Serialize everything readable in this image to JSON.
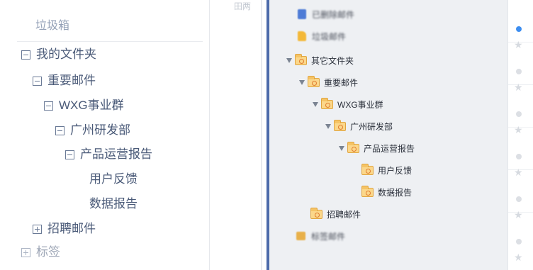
{
  "left_tree": {
    "trash_label": "垃圾箱",
    "items": [
      {
        "label": "我的文件夹",
        "expander": "minus"
      },
      {
        "label": "重要邮件",
        "expander": "minus"
      },
      {
        "label": "WXG事业群",
        "expander": "minus"
      },
      {
        "label": "广州研发部",
        "expander": "minus"
      },
      {
        "label": "产品运营报告",
        "expander": "minus"
      },
      {
        "label": "用户反馈",
        "expander": "none"
      },
      {
        "label": "数据报告",
        "expander": "none"
      },
      {
        "label": "招聘邮件",
        "expander": "plus"
      },
      {
        "label": "标签",
        "expander": "plus"
      }
    ]
  },
  "middle": {
    "snippet": "田两"
  },
  "right_tree": {
    "deleted_label": "已删除邮件",
    "spam_label": "垃圾邮件",
    "items": [
      {
        "label": "其它文件夹",
        "expanded": true
      },
      {
        "label": "重要邮件",
        "expanded": true
      },
      {
        "label": "WXG事业群",
        "expanded": true
      },
      {
        "label": "广州研发部",
        "expanded": true
      },
      {
        "label": "产品运营报告",
        "expanded": true
      },
      {
        "label": "用户反馈",
        "expanded": false
      },
      {
        "label": "数据报告",
        "expanded": false
      },
      {
        "label": "招聘邮件",
        "expanded": false
      }
    ],
    "tags_label": "标签邮件"
  },
  "list_column": {
    "rows": [
      {
        "unread": true
      },
      {
        "unread": false
      },
      {
        "unread": false
      },
      {
        "unread": false
      },
      {
        "unread": false
      },
      {
        "unread": false
      }
    ],
    "star_glyph": "★"
  },
  "colors": {
    "accent_blue": "#4d6baa",
    "unread_dot": "#3d8ef0",
    "folder_fill": "#fbd78a",
    "tree_panel_bg": "#eef0f3"
  }
}
